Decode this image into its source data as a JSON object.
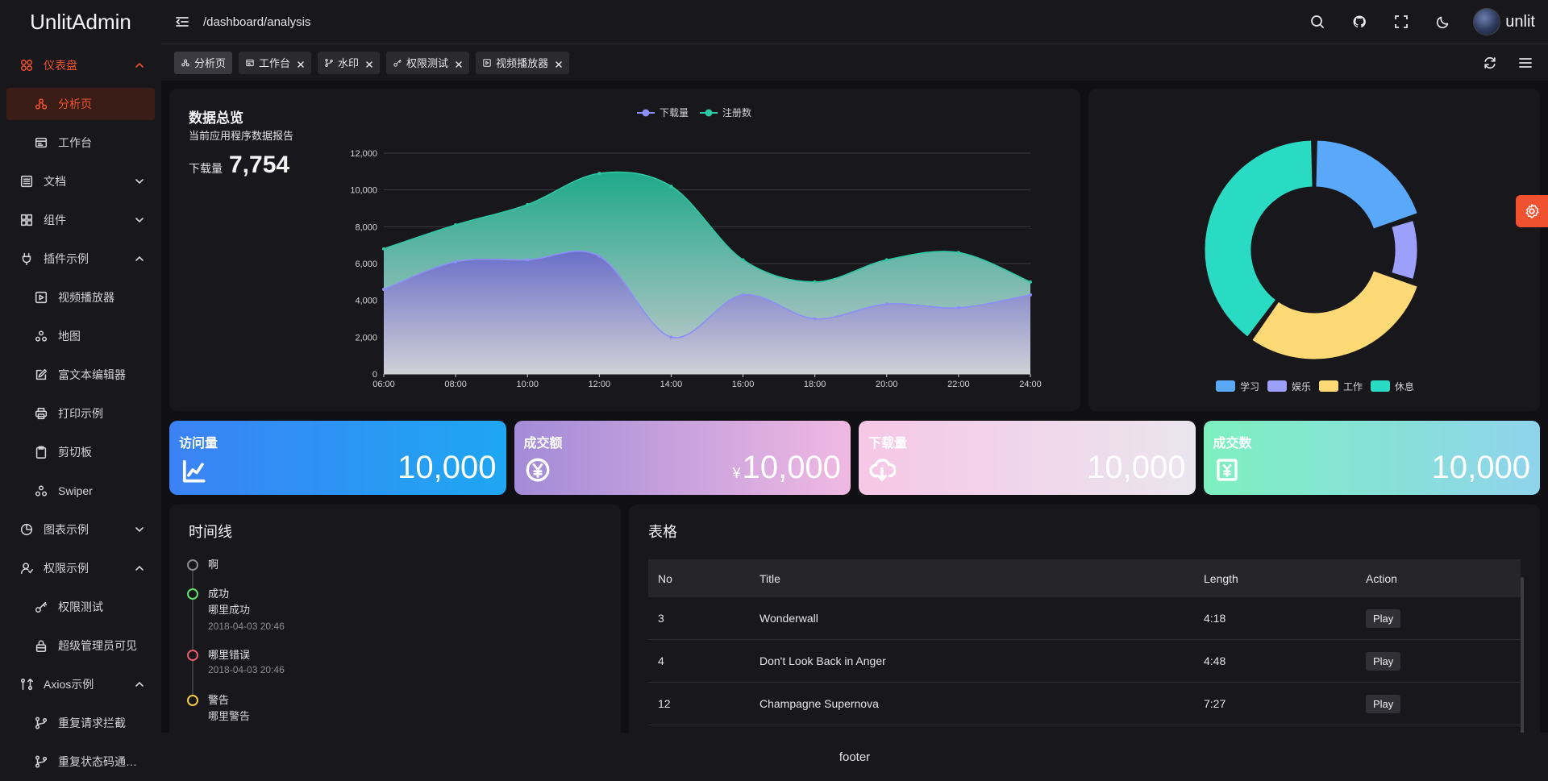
{
  "app": {
    "logo": "UnlitAdmin"
  },
  "sidebar": {
    "items": [
      {
        "label": "仪表盘",
        "icon": "dashboard-icon",
        "kind": "group",
        "state": "group-active",
        "chevron": "up"
      },
      {
        "label": "分析页",
        "icon": "analysis-icon",
        "kind": "sub",
        "state": "active"
      },
      {
        "label": "工作台",
        "icon": "workbench-icon",
        "kind": "sub"
      },
      {
        "label": "文档",
        "icon": "document-icon",
        "kind": "group",
        "chevron": "down"
      },
      {
        "label": "组件",
        "icon": "components-icon",
        "kind": "group",
        "chevron": "down"
      },
      {
        "label": "插件示例",
        "icon": "plugin-icon",
        "kind": "group",
        "chevron": "up"
      },
      {
        "label": "视频播放器",
        "icon": "video-player-icon",
        "kind": "sub"
      },
      {
        "label": "地图",
        "icon": "map-icon",
        "kind": "sub"
      },
      {
        "label": "富文本编辑器",
        "icon": "rich-text-icon",
        "kind": "sub"
      },
      {
        "label": "打印示例",
        "icon": "printer-icon",
        "kind": "sub"
      },
      {
        "label": "剪切板",
        "icon": "clipboard-icon",
        "kind": "sub"
      },
      {
        "label": "Swiper",
        "icon": "swiper-icon",
        "kind": "sub"
      },
      {
        "label": "图表示例",
        "icon": "chart-icon",
        "kind": "group",
        "chevron": "down"
      },
      {
        "label": "权限示例",
        "icon": "permission-icon",
        "kind": "group",
        "chevron": "up"
      },
      {
        "label": "权限测试",
        "icon": "key-icon",
        "kind": "sub"
      },
      {
        "label": "超级管理员可见",
        "icon": "lock-icon",
        "kind": "sub"
      },
      {
        "label": "Axios示例",
        "icon": "axios-icon",
        "kind": "group",
        "chevron": "up"
      },
      {
        "label": "重复请求拦截",
        "icon": "branch-icon",
        "kind": "sub"
      },
      {
        "label": "重复状态码通知...",
        "icon": "branch-icon",
        "kind": "sub"
      }
    ]
  },
  "header": {
    "breadcrumb": "/dashboard/analysis",
    "username": "unlit",
    "icons": [
      "search-icon",
      "github-icon",
      "fullscreen-icon",
      "dark-mode-icon"
    ]
  },
  "tabs": [
    {
      "label": "分析页",
      "icon": "analysis-icon",
      "active": true,
      "closable": false
    },
    {
      "label": "工作台",
      "icon": "workbench-icon",
      "closable": true
    },
    {
      "label": "水印",
      "icon": "branch-icon",
      "closable": true
    },
    {
      "label": "权限测试",
      "icon": "key-icon",
      "closable": true
    },
    {
      "label": "视频播放器",
      "icon": "video-player-icon",
      "closable": true
    }
  ],
  "overview": {
    "title": "数据总览",
    "subtitle": "当前应用程序数据报告",
    "download_label": "下载量",
    "download_value": "7,754"
  },
  "stats": [
    {
      "title": "访问量",
      "value": "10,000",
      "currency": "",
      "icon": "trend-chart-icon"
    },
    {
      "title": "成交额",
      "value": "10,000",
      "currency": "¥",
      "icon": "yen-coin-icon"
    },
    {
      "title": "下载量",
      "value": "10,000",
      "currency": "",
      "icon": "cloud-download-icon"
    },
    {
      "title": "成交数",
      "value": "10,000",
      "currency": "",
      "icon": "yen-ticket-icon"
    }
  ],
  "timeline": {
    "title": "时间线",
    "items": [
      {
        "title": "啊",
        "content": "",
        "time": "",
        "color": "#8b8b93"
      },
      {
        "title": "成功",
        "content": "哪里成功",
        "time": "2018-04-03 20:46",
        "color": "#63e26b"
      },
      {
        "title": "哪里错误",
        "content": "",
        "time": "2018-04-03 20:46",
        "color": "#e85c6a"
      },
      {
        "title": "警告",
        "content": "哪里警告",
        "time": "",
        "color": "#f2c94c"
      }
    ]
  },
  "table": {
    "title": "表格",
    "columns": [
      "No",
      "Title",
      "Length",
      "Action"
    ],
    "rows": [
      {
        "no": "3",
        "title": "Wonderwall",
        "length": "4:18",
        "action": "Play"
      },
      {
        "no": "4",
        "title": "Don't Look Back in Anger",
        "length": "4:48",
        "action": "Play"
      },
      {
        "no": "12",
        "title": "Champagne Supernova",
        "length": "7:27",
        "action": "Play"
      }
    ]
  },
  "footer": {
    "text": "footer"
  },
  "colors": {
    "accent": "#f0512f",
    "series_download": "#8c8ff8",
    "series_register": "#2fc7a4"
  },
  "chart_data": [
    {
      "type": "area",
      "legend_position": "top-center",
      "grid": true,
      "x": [
        "06:00",
        "08:00",
        "10:00",
        "12:00",
        "14:00",
        "16:00",
        "18:00",
        "20:00",
        "22:00",
        "24:00"
      ],
      "ylim": [
        0,
        12000
      ],
      "yticks": [
        "0",
        "2,000",
        "4,000",
        "6,000",
        "8,000",
        "10,000",
        "12,000"
      ],
      "series": [
        {
          "name": "下载量",
          "color": "#8c8ff8",
          "values": [
            4600,
            6100,
            6200,
            6400,
            2000,
            4300,
            3000,
            3800,
            3600,
            4300
          ]
        },
        {
          "name": "注册数",
          "color": "#2fc7a4",
          "values": [
            6800,
            8100,
            9200,
            10900,
            10200,
            6200,
            5000,
            6200,
            6600,
            5000
          ]
        }
      ]
    },
    {
      "type": "pie",
      "donut": true,
      "legend_position": "bottom",
      "series": [
        {
          "name": "学习",
          "color": "#5aa8fa",
          "value": 20
        },
        {
          "name": "娱乐",
          "color": "#9da0fb",
          "value": 10
        },
        {
          "name": "工作",
          "color": "#fcd974",
          "value": 30
        },
        {
          "name": "休息",
          "color": "#2adbc4",
          "value": 40
        }
      ]
    }
  ]
}
